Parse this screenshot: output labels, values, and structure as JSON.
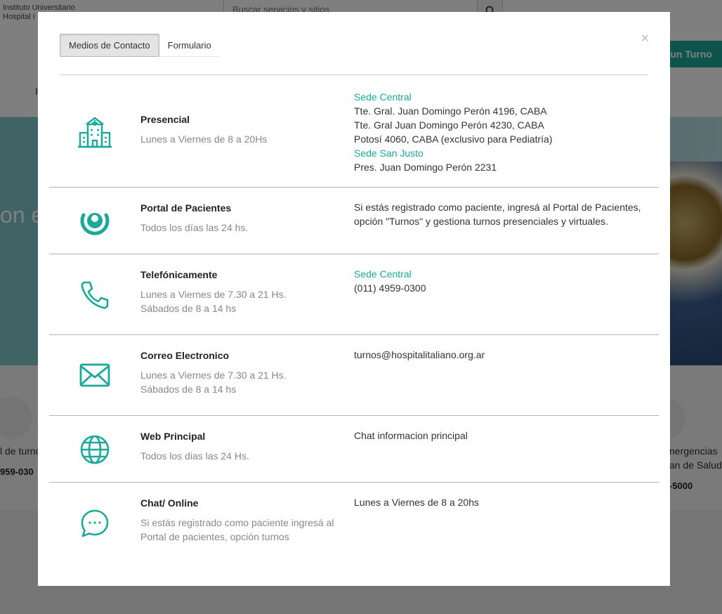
{
  "background": {
    "logo_line1": "Instituto Universitario",
    "logo_line2": "Hospital I",
    "search_placeholder": "Buscar servicios y sitios",
    "turno_button": "a un Turno",
    "nav_fragment": "I",
    "hero_text": "on e",
    "band_left_label": "l de turno",
    "band_left_phone": "959-030",
    "band_right_label1": "nergencias",
    "band_right_label2": "an de Salud",
    "band_right_phone": "-5000"
  },
  "modal": {
    "close_label": "×",
    "tabs": [
      {
        "label": "Medios de Contacto",
        "active": true
      },
      {
        "label": "Formulario",
        "active": false
      }
    ],
    "rows": [
      {
        "icon": "hospital-icon",
        "title": "Presencial",
        "sub": [
          "Lunes a Viernes de 8 a 20Hs"
        ],
        "info": [
          {
            "text": "Sede Central",
            "highlight": true
          },
          {
            "text": "Tte. Gral. Juan Domingo Perón 4196, CABA",
            "highlight": false
          },
          {
            "text": "Tte. Gral Juan Domingo Perón 4230, CABA",
            "highlight": false
          },
          {
            "text": "Potosí 4060, CABA (exclusivo para Pediatría)",
            "highlight": false
          },
          {
            "text": "Sede San Justo",
            "highlight": true
          },
          {
            "text": "Pres. Juan Domingo Perón 2231",
            "highlight": false
          }
        ]
      },
      {
        "icon": "patient-portal-icon",
        "title": "Portal de Pacientes",
        "sub": [
          "Todos los días las 24 hs."
        ],
        "info": [
          {
            "text": "Si estás registrado como paciente, ingresá al Portal de Pacientes, opción \"Turnos\" y gestiona turnos presenciales y virtuales.",
            "highlight": false
          }
        ]
      },
      {
        "icon": "phone-icon",
        "title": "Telefónicamente",
        "sub": [
          "Lunes a Viernes de 7.30 a 21 Hs.",
          "Sábados de 8 a 14 hs"
        ],
        "info": [
          {
            "text": "Sede Central",
            "highlight": true
          },
          {
            "text": "(011) 4959-0300",
            "highlight": false
          }
        ]
      },
      {
        "icon": "mail-icon",
        "title": "Correo Electronico",
        "sub": [
          "Lunes a Viernes de 7.30 a 21 Hs.",
          "Sábados de 8 a 14 hs"
        ],
        "info": [
          {
            "text": "turnos@hospitalitaliano.org.ar",
            "highlight": false
          }
        ]
      },
      {
        "icon": "globe-icon",
        "title": "Web Principal",
        "sub": [
          "Todos los dias las 24 Hs."
        ],
        "info": [
          {
            "text": "Chat informacion principal",
            "highlight": false
          }
        ]
      },
      {
        "icon": "chat-icon",
        "title": "Chat/ Online",
        "sub": [
          "Si estás registrado como paciente ingresá al Portal de pacientes, opción turnos"
        ],
        "info": [
          {
            "text": "Lunes a Viernes de 8 a 20hs",
            "highlight": false
          }
        ]
      }
    ]
  },
  "colors": {
    "accent": "#1aa99a",
    "overlay": "rgba(0,0,0,0.5)",
    "subtext": "#888888"
  }
}
